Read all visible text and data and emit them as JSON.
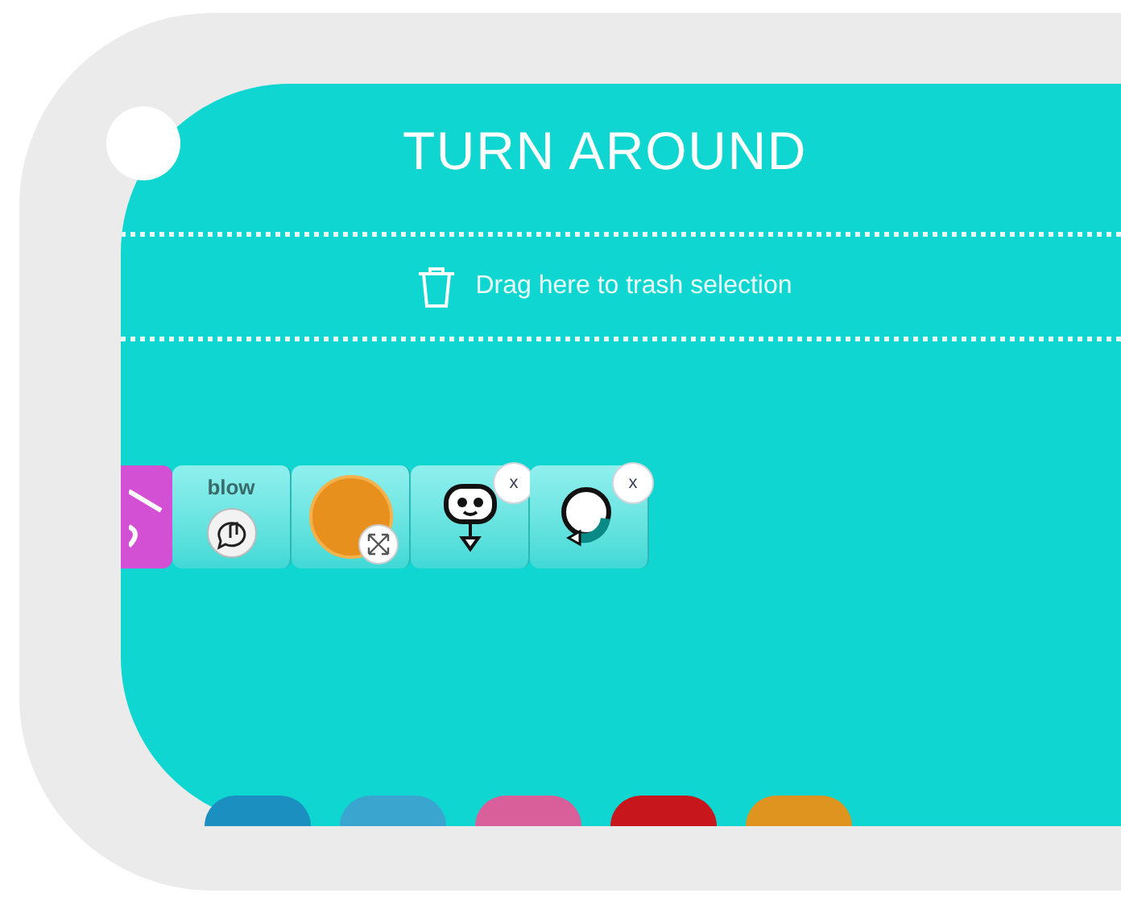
{
  "title": "TURN AROUND",
  "trash_hint": "Drag here to trash selection",
  "blocks": [
    {
      "kind": "cut"
    },
    {
      "kind": "sound",
      "label": "blow"
    },
    {
      "kind": "photo"
    },
    {
      "kind": "robot",
      "remove_label": "x"
    },
    {
      "kind": "turn",
      "remove_label": "x"
    }
  ],
  "balls": [
    {
      "color": "#1a8fc0"
    },
    {
      "color": "#3aa6d0"
    },
    {
      "color": "#d95f9a"
    },
    {
      "color": "#c8161d"
    },
    {
      "color": "#e09420"
    }
  ]
}
